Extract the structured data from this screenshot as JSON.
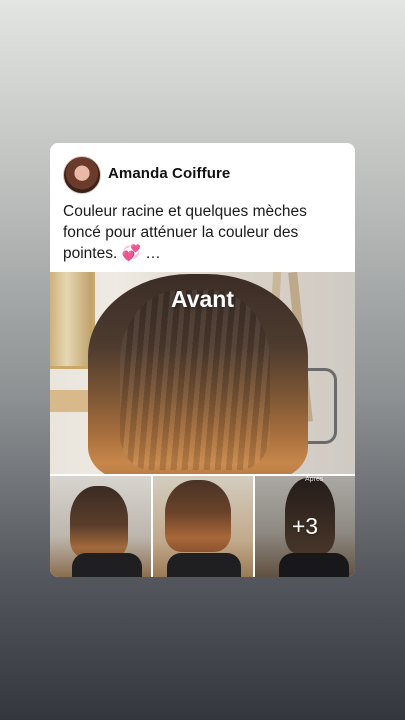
{
  "post": {
    "author": "Amanda Coiffure",
    "caption_text": "Couleur racine et quelques mèches foncé pour atténuer la couleur des pointes. ",
    "caption_emoji": "💞",
    "caption_more": "…",
    "main_photo_label": "Avant",
    "thumb_label": "Après",
    "more_photos": "+3"
  }
}
